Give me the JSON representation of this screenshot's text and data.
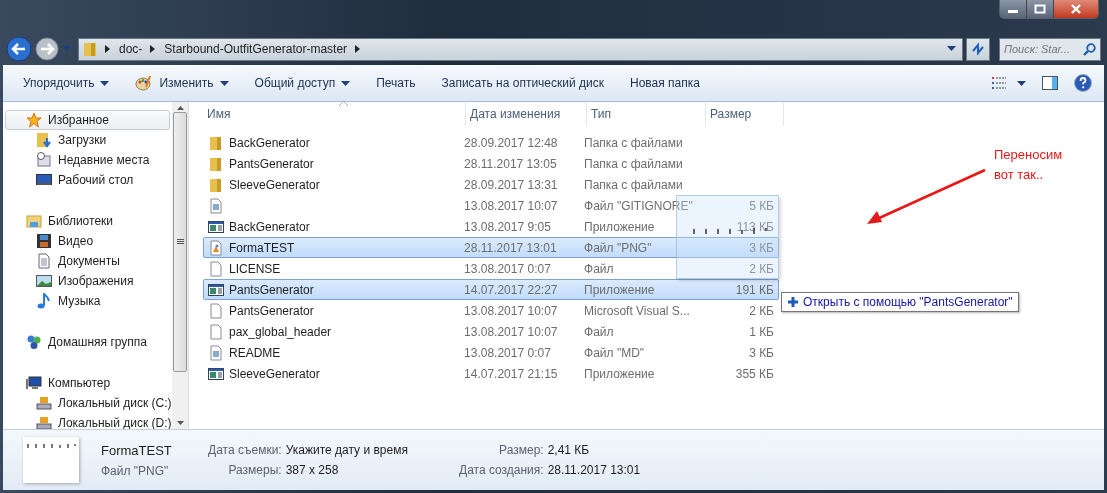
{
  "address_bar": {
    "path": [
      "doc-",
      "Starbound-OutfitGenerator-master"
    ]
  },
  "search": {
    "placeholder": "Поиск: Star..."
  },
  "toolbar": [
    {
      "label": "Упорядочить",
      "dropdown": true,
      "kind": "plain"
    },
    {
      "label": "Изменить",
      "dropdown": true,
      "kind": "paint"
    },
    {
      "label": "Общий доступ",
      "dropdown": true,
      "kind": "plain"
    },
    {
      "label": "Печать",
      "dropdown": false,
      "kind": "plain"
    },
    {
      "label": "Записать на оптический диск",
      "dropdown": false,
      "kind": "plain"
    },
    {
      "label": "Новая папка",
      "dropdown": false,
      "kind": "plain"
    }
  ],
  "sidebar": {
    "groups": [
      {
        "label": "Избранное",
        "kind": "star",
        "selected": true,
        "children": [
          {
            "label": "Загрузки",
            "kind": "downloads",
            "selected": false
          },
          {
            "label": "Недавние места",
            "kind": "recent",
            "selected": false
          },
          {
            "label": "Рабочий стол",
            "kind": "desktop",
            "selected": false
          }
        ]
      },
      {
        "label": "Библиотеки",
        "kind": "library",
        "selected": false,
        "children": [
          {
            "label": "Видео",
            "kind": "video",
            "selected": false
          },
          {
            "label": "Документы",
            "kind": "document",
            "selected": false
          },
          {
            "label": "Изображения",
            "kind": "image",
            "selected": false
          },
          {
            "label": "Музыка",
            "kind": "music",
            "selected": false
          }
        ]
      },
      {
        "label": "Домашняя группа",
        "kind": "homegroup",
        "selected": false
      },
      {
        "label": "Компьютер",
        "kind": "computer",
        "selected": false,
        "children": [
          {
            "label": "Локальный диск (C:)",
            "kind": "disk",
            "selected": false
          },
          {
            "label": "Локальный диск (D:)",
            "kind": "disk",
            "selected": false
          }
        ]
      }
    ]
  },
  "table": {
    "columns": [
      "Имя",
      "Дата изменения",
      "Тип",
      "Размер"
    ],
    "rows": [
      {
        "name": "BackGenerator",
        "date": "28.09.2017 12:48",
        "type": "Папка с файлами",
        "kind": "folder",
        "selected": false
      },
      {
        "name": "PantsGenerator",
        "date": "28.11.2017 13:05",
        "type": "Папка с файлами",
        "kind": "folder",
        "selected": false
      },
      {
        "name": "SleeveGenerator",
        "date": "28.09.2017 13:31",
        "type": "Папка с файлами",
        "kind": "folder",
        "selected": false
      },
      {
        "date": "13.08.2017 10:07",
        "type": "Файл \"GITIGNORE\"",
        "size": "5 КБ",
        "kind": "text",
        "selected": false
      },
      {
        "name": "BackGenerator",
        "date": "13.08.2017 9:05",
        "type": "Приложение",
        "size": "113 КБ",
        "kind": "app",
        "selected": false
      },
      {
        "name": "FormaTEST",
        "date": "28.11.2017 13:01",
        "type": "Файл \"PNG\"",
        "size": "3 КБ",
        "kind": "image",
        "selected": true
      },
      {
        "name": "LICENSE",
        "date": "13.08.2017 0:07",
        "type": "Файл",
        "size": "2 КБ",
        "kind": "blank",
        "selected": false
      },
      {
        "name": "PantsGenerator",
        "date": "14.07.2017 22:27",
        "type": "Приложение",
        "size": "191 КБ",
        "kind": "app",
        "selected": true
      },
      {
        "name": "PantsGenerator",
        "date": "13.08.2017 10:07",
        "type": "Microsoft Visual S...",
        "size": "2 КБ",
        "kind": "blank",
        "selected": false
      },
      {
        "name": "pax_global_header",
        "date": "13.08.2017 10:07",
        "type": "Файл",
        "size": "1 КБ",
        "kind": "blank",
        "selected": false
      },
      {
        "name": "README",
        "date": "13.08.2017 0:07",
        "type": "Файл \"MD\"",
        "size": "3 КБ",
        "kind": "text",
        "selected": false
      },
      {
        "name": "SleeveGenerator",
        "date": "14.07.2017 21:15",
        "type": "Приложение",
        "size": "355 КБ",
        "kind": "app",
        "selected": false
      }
    ]
  },
  "drag": {
    "tooltip": "Открыть с помощью \"PantsGenerator\""
  },
  "annotation": {
    "lines": [
      "Переносим",
      "вот так.."
    ]
  },
  "details": {
    "name": "FormaTEST",
    "type": "Файл \"PNG\"",
    "fields": [
      {
        "label": "Дата съемки:",
        "value": "Укажите дату и время"
      },
      {
        "label": "Размеры:",
        "value": "387 x 258"
      }
    ],
    "fields_right": [
      {
        "label": "Размер:",
        "value": "2,41 КБ"
      },
      {
        "label": "Дата создания:",
        "value": "28.11.2017 13:01"
      }
    ]
  }
}
